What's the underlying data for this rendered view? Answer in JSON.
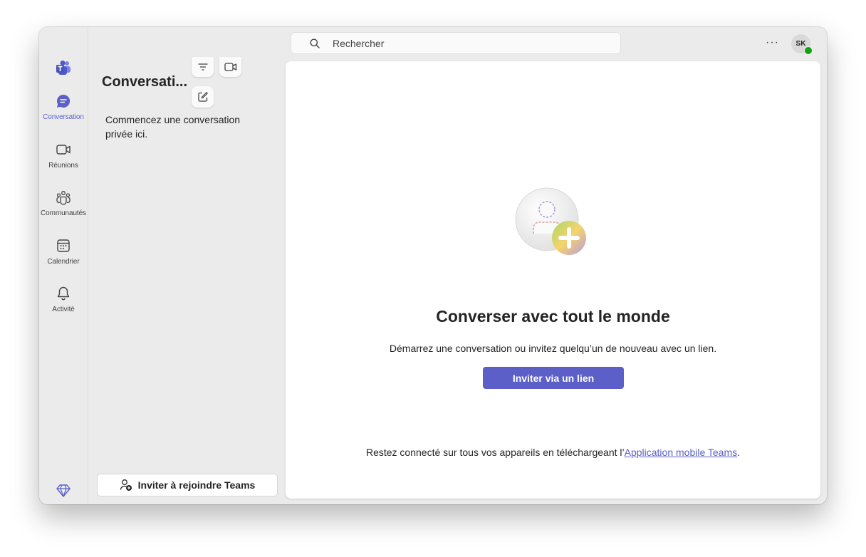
{
  "nav": {
    "items": [
      {
        "label": "Conversation",
        "icon": "chat-icon",
        "active": true
      },
      {
        "label": "Réunions",
        "icon": "video-icon",
        "active": false
      },
      {
        "label": "Communautés",
        "icon": "communities-icon",
        "active": false
      },
      {
        "label": "Calendrier",
        "icon": "calendar-icon",
        "active": false
      },
      {
        "label": "Activité",
        "icon": "bell-icon",
        "active": false
      }
    ]
  },
  "search": {
    "placeholder": "Rechercher"
  },
  "user": {
    "initials": "SK",
    "status": "available"
  },
  "list": {
    "title": "Conversati...",
    "empty_text": "Commencez une conversation privée ici.",
    "invite_button": "Inviter à rejoindre Teams"
  },
  "main": {
    "headline": "Converser avec tout le monde",
    "subline": "Démarrez une conversation ou invitez quelqu’un de nouveau avec un lien.",
    "invite_button": "Inviter via un lien",
    "footer_prefix": "Restez connecté sur tous vos appareils en téléchargeant l’",
    "footer_link": "Application mobile Teams",
    "footer_suffix": "."
  },
  "colors": {
    "accent": "#5b5fc7",
    "presence": "#13a10e"
  }
}
